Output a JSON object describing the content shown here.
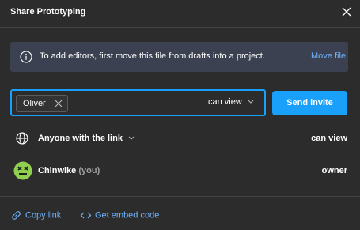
{
  "header": {
    "title": "Share Prototyping",
    "close_icon": "close-icon"
  },
  "banner": {
    "icon": "info-icon",
    "text": "To add editors, first move this file from drafts into a project.",
    "action_label": "Move file"
  },
  "invite": {
    "chips": [
      {
        "label": "Oliver",
        "remove_icon": "close-icon"
      }
    ],
    "permission": "can view",
    "send_label": "Send invite"
  },
  "link_access": {
    "icon": "globe-icon",
    "label": "Anyone with the link",
    "permission": "can view"
  },
  "members": [
    {
      "name": "Chinwike",
      "suffix": "(you)",
      "role": "owner",
      "avatar": "emoji-avatar",
      "avatar_color": "#8fd14f"
    }
  ],
  "footer": {
    "copy_link_label": "Copy link",
    "embed_label": "Get embed code"
  },
  "colors": {
    "background": "#2c2c2c",
    "banner_bg": "#3b4150",
    "accent": "#18a0fb",
    "link": "#6fb4ff"
  }
}
